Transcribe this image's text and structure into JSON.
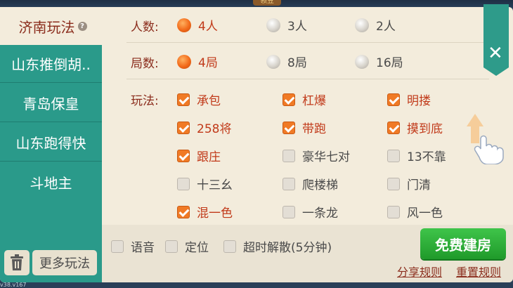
{
  "top_badge": "领豆",
  "sidebar": {
    "tabs": [
      {
        "label": "济南玩法",
        "active": true
      },
      {
        "label": "山东推倒胡..",
        "active": false
      },
      {
        "label": "青岛保皇",
        "active": false
      },
      {
        "label": "山东跑得快",
        "active": false
      },
      {
        "label": "斗地主",
        "active": false
      }
    ],
    "help_glyph": "?",
    "more_label": "更多玩法"
  },
  "players": {
    "label": "人数:",
    "options": [
      {
        "label": "4人",
        "selected": true
      },
      {
        "label": "3人",
        "selected": false
      },
      {
        "label": "2人",
        "selected": false
      }
    ]
  },
  "rounds": {
    "label": "局数:",
    "options": [
      {
        "label": "4局",
        "selected": true
      },
      {
        "label": "8局",
        "selected": false
      },
      {
        "label": "16局",
        "selected": false
      }
    ]
  },
  "rules": {
    "label": "玩法:",
    "options": [
      {
        "label": "承包",
        "checked": true
      },
      {
        "label": "杠爆",
        "checked": true
      },
      {
        "label": "明搂",
        "checked": true
      },
      {
        "label": "258将",
        "checked": true
      },
      {
        "label": "带跑",
        "checked": true
      },
      {
        "label": "摸到底",
        "checked": true
      },
      {
        "label": "跟庄",
        "checked": true
      },
      {
        "label": "豪华七对",
        "checked": false
      },
      {
        "label": "13不靠",
        "checked": false
      },
      {
        "label": "十三幺",
        "checked": false
      },
      {
        "label": "爬楼梯",
        "checked": false
      },
      {
        "label": "门清",
        "checked": false
      },
      {
        "label": "混一色",
        "checked": true
      },
      {
        "label": "一条龙",
        "checked": false
      },
      {
        "label": "风一色",
        "checked": false
      }
    ]
  },
  "footer": {
    "voice": {
      "label": "语音",
      "checked": false
    },
    "location": {
      "label": "定位",
      "checked": false
    },
    "timeout": {
      "label": "超时解散(5分钟)",
      "checked": false
    },
    "create_label": "免费建房",
    "share_label": "分享规则",
    "reset_label": "重置规则"
  },
  "close_glyph": "✕",
  "version": "v38.v167",
  "colors": {
    "accent": "#2a9a8a",
    "selected": "#c13a1a",
    "create": "#2fae3a"
  }
}
